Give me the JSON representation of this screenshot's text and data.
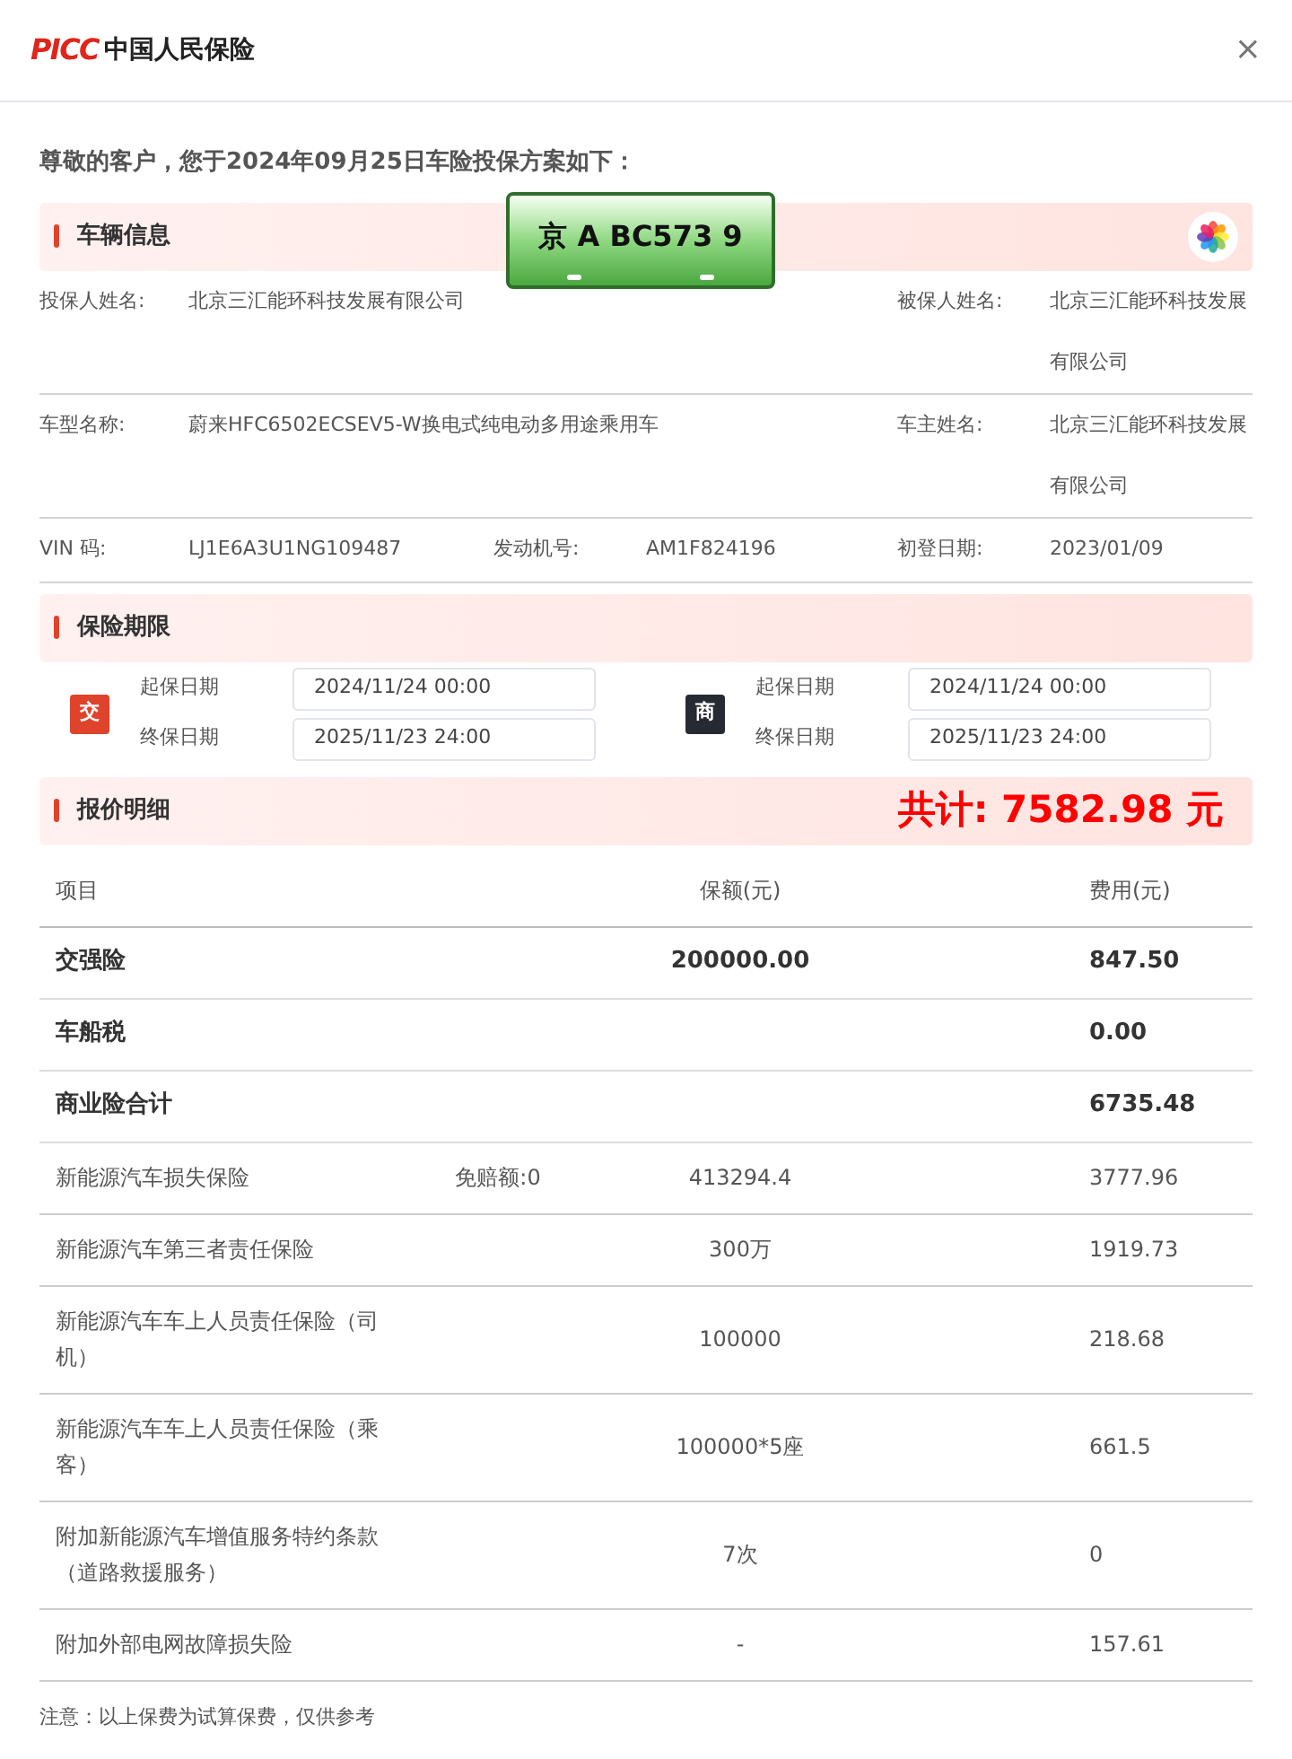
{
  "header": {
    "logo_mark": "PICC",
    "logo_text": "中国人民保险",
    "close": "×"
  },
  "greeting": "尊敬的客户，您于2024年09月25日车险投保方案如下：",
  "vehicle": {
    "title": "车辆信息",
    "plate": "京 A BC573 9",
    "rows": [
      {
        "kind": "wide",
        "cells": [
          {
            "label": "投保人姓名:",
            "value": "北京三汇能环科技发展有限公司"
          },
          {
            "label": "被保人姓名:",
            "value": "北京三汇能环科技发展有限公司"
          }
        ]
      },
      {
        "kind": "wide",
        "cells": [
          {
            "label": "车型名称:",
            "value": "蔚来HFC6502ECSEV5-W换电式纯电动多用途乘用车"
          },
          {
            "label": "车主姓名:",
            "value": "北京三汇能环科技发展有限公司"
          }
        ]
      },
      {
        "kind": "triple",
        "cells": [
          {
            "label": "VIN 码:",
            "value": "LJ1E6A3U1NG109487"
          },
          {
            "label": "发动机号:",
            "value": "AM1F824196"
          },
          {
            "label": "初登日期:",
            "value": "2023/01/09"
          }
        ]
      }
    ]
  },
  "period": {
    "title": "保险期限",
    "policies": [
      {
        "badge": "交",
        "color": "#e0432b",
        "start_label": "起保日期",
        "start": "2024/11/24 00:00",
        "end_label": "终保日期",
        "end": "2025/11/23 24:00"
      },
      {
        "badge": "商",
        "color": "#262a33",
        "start_label": "起保日期",
        "start": "2024/11/24 00:00",
        "end_label": "终保日期",
        "end": "2025/11/23 24:00"
      }
    ]
  },
  "quote": {
    "title": "报价明细",
    "total": "共计: 7582.98 元",
    "columns": [
      "项目",
      "保额(元)",
      "费用(元)"
    ],
    "rows": [
      {
        "kind": "subtotal",
        "item": "交强险",
        "amount": "200000.00",
        "fee": "847.50"
      },
      {
        "kind": "subtotal",
        "item": "车船税",
        "fee": "0.00"
      },
      {
        "kind": "subtotal",
        "item": "商业险合计",
        "fee": "6735.48"
      },
      {
        "kind": "detail",
        "item": "新能源汽车损失保险",
        "deductible": "免赔额:0",
        "amount": "413294.4",
        "fee": "3777.96"
      },
      {
        "kind": "detail",
        "item": "新能源汽车第三者责任保险",
        "amount": "300万",
        "fee": "1919.73"
      },
      {
        "kind": "detail",
        "item": "新能源汽车车上人员责任保险（司机）",
        "amount": "100000",
        "fee": "218.68"
      },
      {
        "kind": "detail",
        "item": "新能源汽车车上人员责任保险（乘客）",
        "amount": "100000*5座",
        "fee": "661.5"
      },
      {
        "kind": "detail",
        "item": "附加新能源汽车增值服务特约条款（道路救援服务）",
        "amount": "7次",
        "fee": "0"
      },
      {
        "kind": "detail",
        "item": "附加外部电网故障损失险",
        "amount": "-",
        "fee": "157.61"
      }
    ]
  },
  "note": "注意：以上保费为试算保费，仅供参考"
}
